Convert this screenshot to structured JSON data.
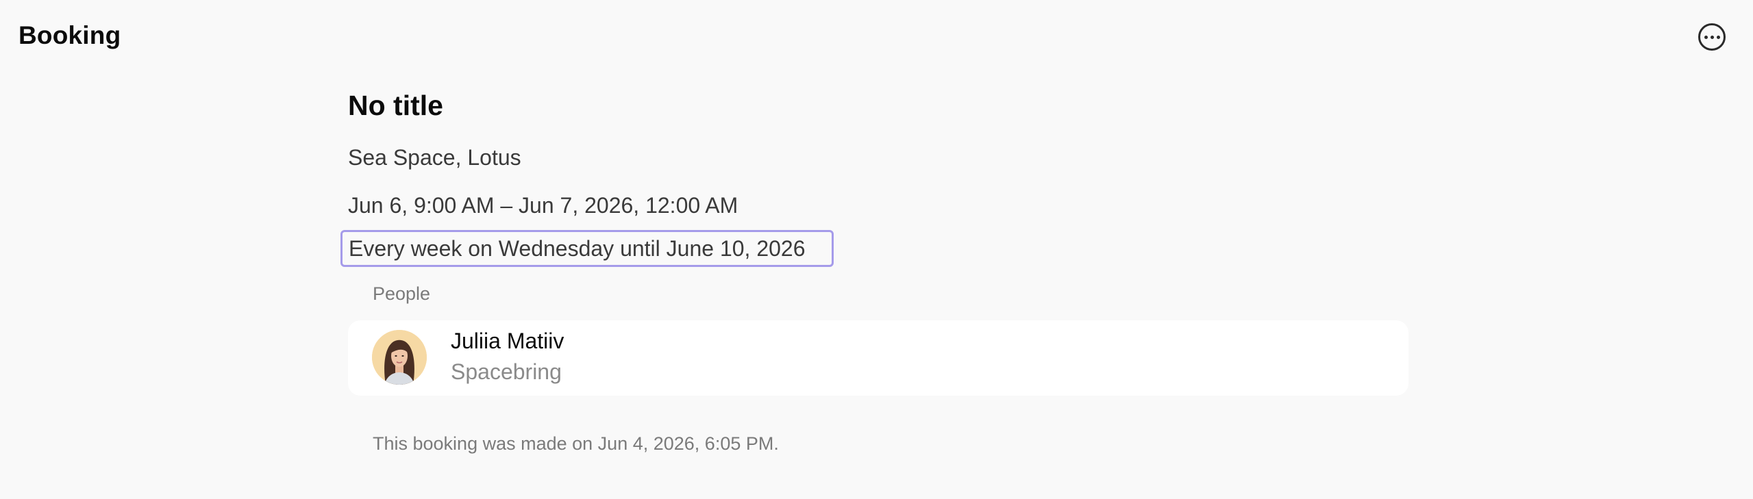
{
  "header": {
    "title": "Booking",
    "more_icon": "more-horizontal-circle-icon"
  },
  "booking": {
    "title": "No title",
    "location": "Sea Space, Lotus",
    "datetime": "Jun 6, 9:00 AM – Jun 7, 2026, 12:00 AM",
    "recurrence": "Every week on Wednesday until June 10, 2026"
  },
  "people": {
    "label": "People",
    "items": [
      {
        "name": "Juliia Matiiv",
        "company": "Spacebring"
      }
    ]
  },
  "footer": {
    "note": "This booking was made on Jun 4, 2026, 6:05 PM."
  },
  "colors": {
    "background": "#f9f9f9",
    "card": "#ffffff",
    "focus_border": "#a59bea",
    "avatar_bg": "#f6d9a4"
  }
}
